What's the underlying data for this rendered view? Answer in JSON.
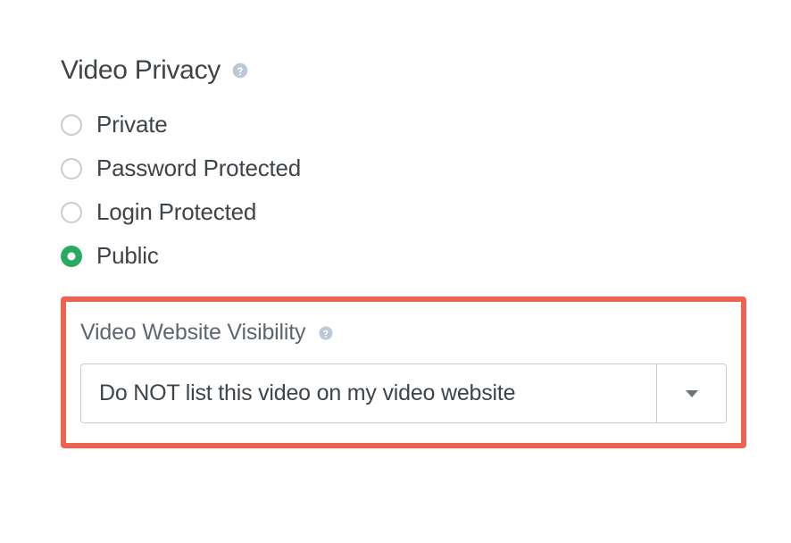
{
  "privacy": {
    "title": "Video Privacy",
    "options": [
      {
        "label": "Private",
        "selected": false
      },
      {
        "label": "Password Protected",
        "selected": false
      },
      {
        "label": "Login Protected",
        "selected": false
      },
      {
        "label": "Public",
        "selected": true
      }
    ]
  },
  "visibility": {
    "title": "Video Website Visibility",
    "selected": "Do NOT list this video on my video website"
  }
}
